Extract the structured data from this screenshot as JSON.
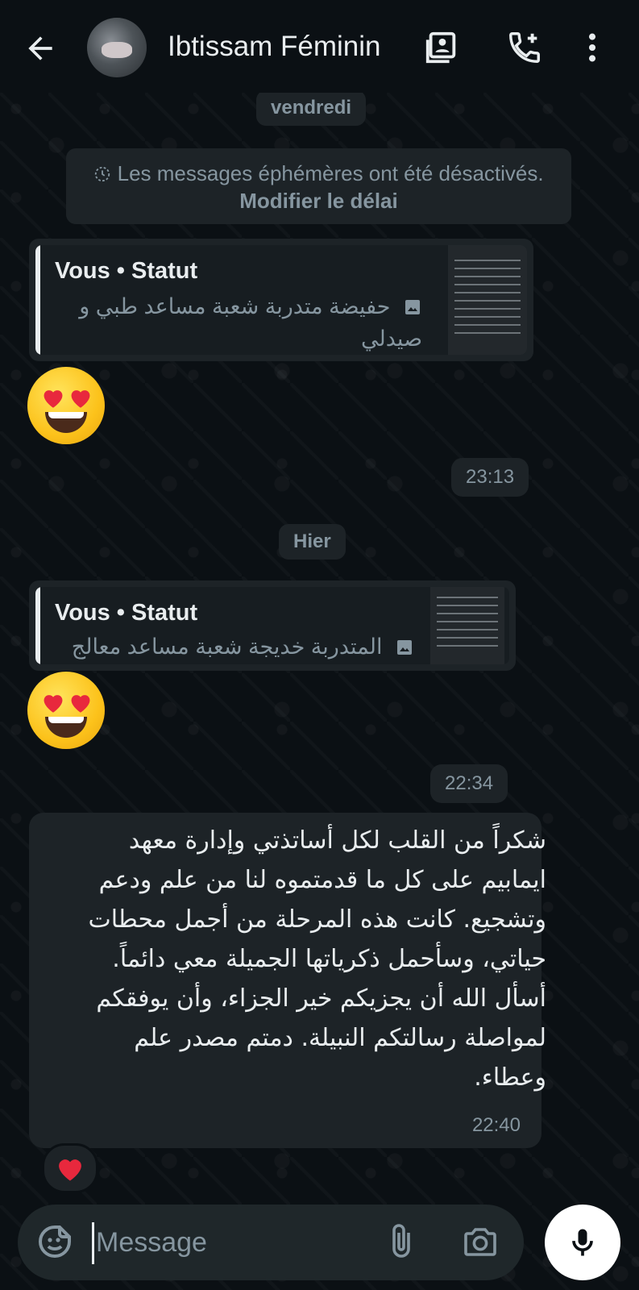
{
  "header": {
    "contact_name": "Ibtissam Féminin",
    "icons": [
      "back-arrow-icon",
      "contact-card-icon",
      "add-call-icon",
      "more-vertical-icon"
    ]
  },
  "chat": {
    "day1": "vendredi",
    "system_message": {
      "text": "Les messages éphémères ont été désactivés.",
      "link": "Modifier le délai"
    },
    "status_reply_1": {
      "title": "Vous • Statut",
      "line1": "حفيضة متدربة شعبة مساعد طبي و",
      "line2": "صيدلي"
    },
    "emoji_1": "😍",
    "time_1": "23:13",
    "day2": "Hier",
    "status_reply_2": {
      "title": "Vous • Statut",
      "line1": "المتدربة خديجة شعبة مساعد معالج"
    },
    "emoji_2": "😍",
    "time_2": "22:34",
    "message": {
      "lines": [
        "شكراً من القلب لكل أساتذتي وإدارة معهد",
        "ايمابيم على كل ما قدمتموه لنا من علم ودعم",
        "وتشجيع. كانت هذه المرحلة من أجمل محطات",
        "حياتي، وسأحمل ذكرياتها الجميلة معي دائماً.",
        "أسأل الله أن يجزيكم خير الجزاء، وأن يوفقكم",
        "لمواصلة رسالتكم النبيلة. دمتم مصدر علم",
        "وعطاء."
      ],
      "time": "22:40",
      "reaction": "❤️"
    }
  },
  "composer": {
    "placeholder": "Message",
    "icons": [
      "sticker-icon",
      "attach-icon",
      "camera-icon",
      "mic-icon"
    ]
  },
  "colors": {
    "background": "#0b1014",
    "bubble": "#1d2327",
    "muted_text": "#8696a0",
    "text": "#e9edef"
  }
}
